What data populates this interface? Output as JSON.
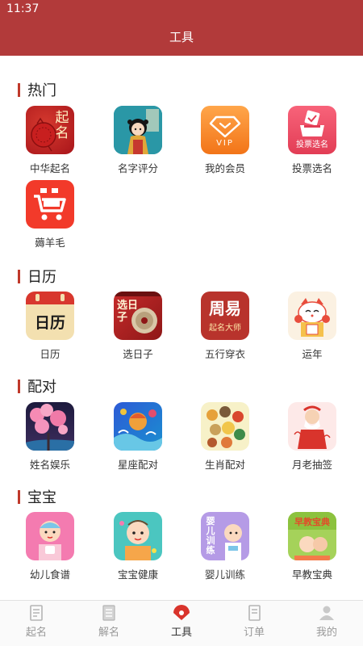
{
  "status_bar": {
    "time": "11:37"
  },
  "header": {
    "title": "工具"
  },
  "sections": {
    "hot": {
      "title": "热门",
      "items": [
        {
          "label": "中华起名",
          "icon": "red-paper-cut-icon",
          "icon_text": "起名"
        },
        {
          "label": "名字评分",
          "icon": "girl-illustration-icon"
        },
        {
          "label": "我的会员",
          "icon": "vip-diamond-icon",
          "icon_text": "VIP"
        },
        {
          "label": "投票选名",
          "icon": "ballot-box-icon",
          "icon_text": "投票选名"
        },
        {
          "label": "薅羊毛",
          "icon": "shopping-cart-icon"
        }
      ]
    },
    "calendar": {
      "title": "日历",
      "items": [
        {
          "label": "日历",
          "icon": "calendar-icon",
          "icon_text": "日历"
        },
        {
          "label": "选日子",
          "icon": "date-picker-icon",
          "icon_text": "选日子"
        },
        {
          "label": "五行穿衣",
          "icon": "zhouyi-master-icon",
          "icon_text": "周易",
          "icon_subtext": "起名大师"
        },
        {
          "label": "运年",
          "icon": "lucky-cat-icon"
        }
      ]
    },
    "match": {
      "title": "配对",
      "items": [
        {
          "label": "姓名娱乐",
          "icon": "sakura-icon"
        },
        {
          "label": "星座配对",
          "icon": "constellation-icon"
        },
        {
          "label": "生肖配对",
          "icon": "zodiac-animals-icon"
        },
        {
          "label": "月老抽签",
          "icon": "matchmaker-icon"
        }
      ]
    },
    "baby": {
      "title": "宝宝",
      "items": [
        {
          "label": "幼儿食谱",
          "icon": "baby-food-icon"
        },
        {
          "label": "宝宝健康",
          "icon": "baby-health-icon"
        },
        {
          "label": "婴儿训练",
          "icon": "baby-training-icon",
          "icon_text": "婴儿训练"
        },
        {
          "label": "早教宝典",
          "icon": "early-education-icon",
          "icon_text": "早教宝典"
        }
      ]
    }
  },
  "tabbar": {
    "items": [
      {
        "label": "起名",
        "icon": "naming-book-icon"
      },
      {
        "label": "解名",
        "icon": "explain-book-icon"
      },
      {
        "label": "工具",
        "icon": "fan-tool-icon"
      },
      {
        "label": "订单",
        "icon": "order-doc-icon"
      },
      {
        "label": "我的",
        "icon": "profile-icon"
      }
    ],
    "active": "工具"
  },
  "colors": {
    "brand": "#b23a3a",
    "accent": "#c0392b"
  }
}
